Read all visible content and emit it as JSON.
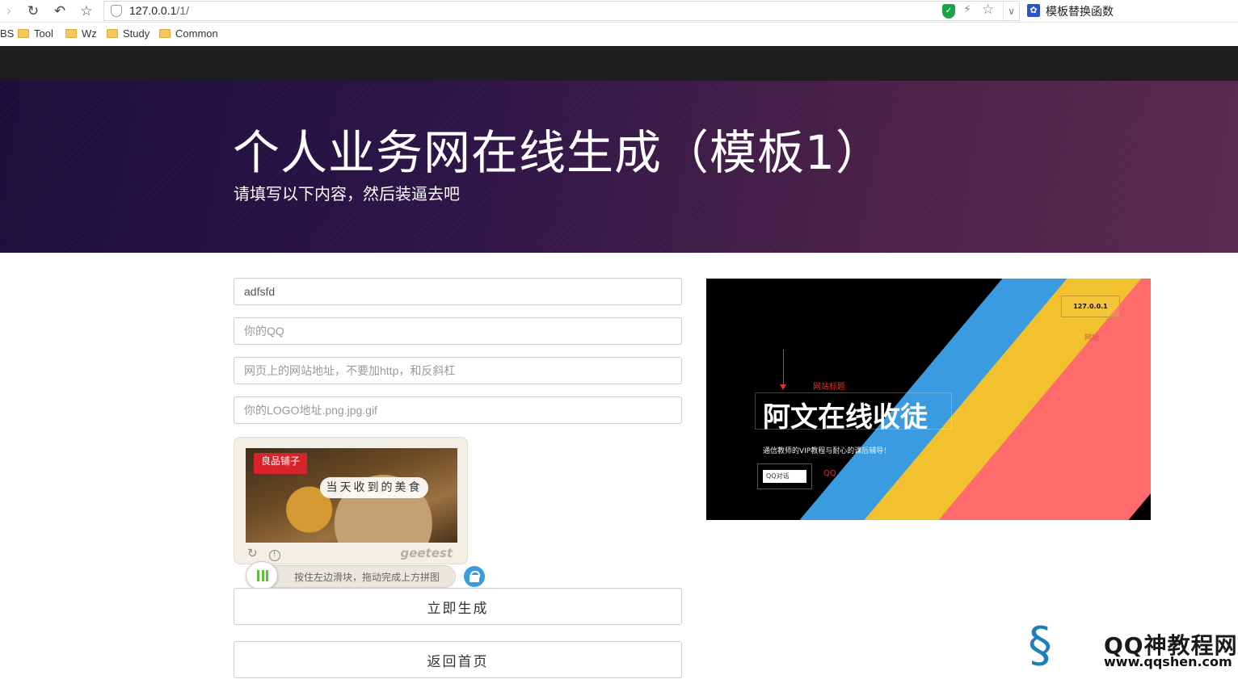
{
  "browser": {
    "url_host": "127.0.0.1",
    "url_path": "/1/",
    "search_text": "模板替换函数",
    "bookmarks": [
      "BS",
      "Tool",
      "Wz",
      "Study",
      "Common"
    ]
  },
  "hero": {
    "title": "个人业务网在线生成（模板1）",
    "subtitle": "请填写以下内容，然后装逼去吧"
  },
  "form": {
    "site_title_value": "adfsfd",
    "qq_placeholder": "你的QQ",
    "url_placeholder": "网页上的网站地址，不要加http，和反斜杠",
    "logo_placeholder": "你的LOGO地址.png.jpg.gif",
    "generate_label": "立即生成",
    "home_label": "返回首页"
  },
  "captcha": {
    "brand": "良品铺子",
    "banner": "当天收到的美食",
    "provider": "geetest",
    "slider_hint": "按住左边滑块，拖动完成上方拼图"
  },
  "preview": {
    "ip": "127.0.0.1",
    "title_label": "网站标题",
    "title": "阿文在线收徒",
    "desc": "通信教师的VIP教程与耐心的课后辅导！",
    "qq_button": "QQ对话",
    "qq_label": "QQ",
    "url_label": "网址"
  },
  "watermark": {
    "name": "QQ神教程网",
    "site": "www.qqshen.com"
  },
  "colors": {
    "stripe_blue": "#3a9be0",
    "stripe_yellow": "#f2c12e",
    "stripe_red": "#ff6b6b",
    "accent_lock": "#3a9be0"
  }
}
